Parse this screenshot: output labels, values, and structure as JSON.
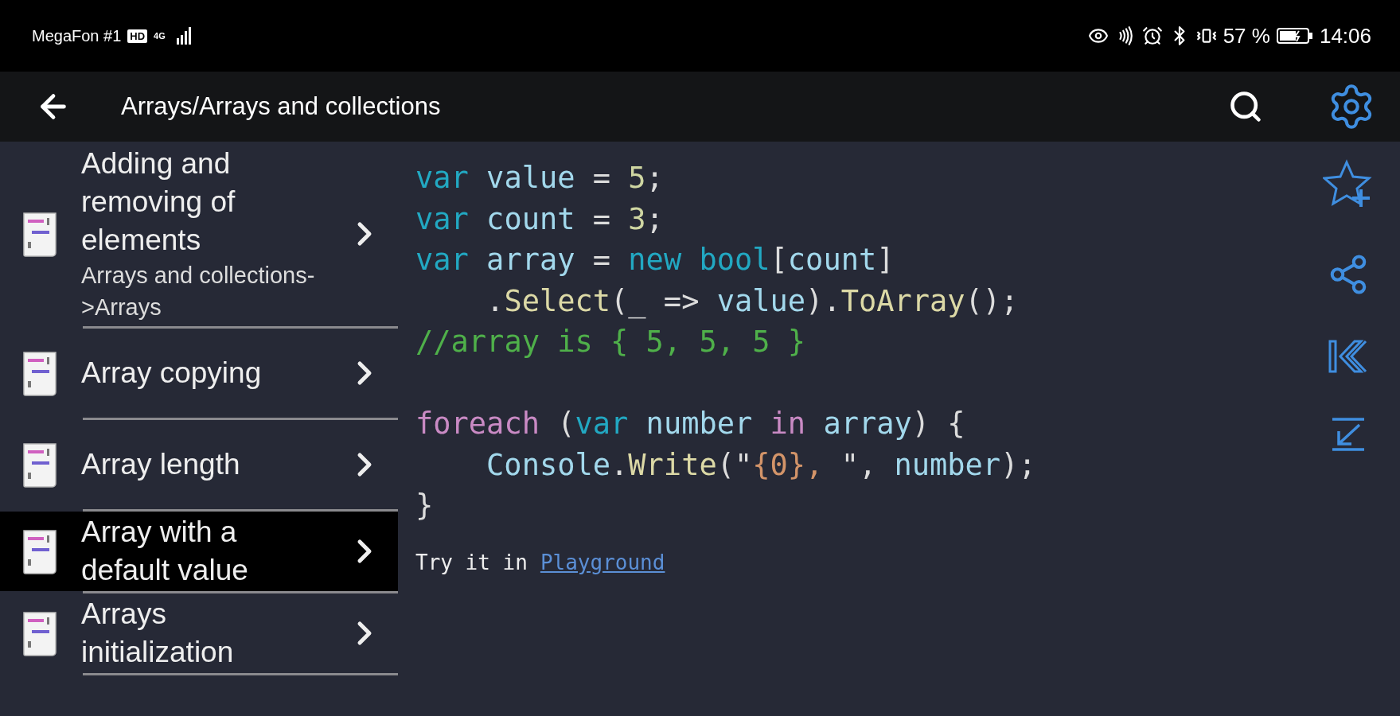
{
  "status_bar": {
    "carrier": "MegaFon #1",
    "hd_badge": "HD",
    "network": "4G",
    "battery_percent": "57 %",
    "time": "14:06"
  },
  "toolbar": {
    "title": "Arrays/Arrays and collections"
  },
  "sidebar": {
    "items": [
      {
        "title": "Adding and removing of elements",
        "subtitle": "Arrays and collections->Arrays",
        "selected": false
      },
      {
        "title": "Array copying",
        "selected": false
      },
      {
        "title": "Array length",
        "selected": false
      },
      {
        "title": "Array with a default value",
        "selected": true
      },
      {
        "title": "Arrays initialization",
        "selected": false
      }
    ]
  },
  "code": {
    "lines": [
      {
        "indent": false,
        "gap_before": false,
        "tokens": [
          {
            "kind": "keyword",
            "text": "var "
          },
          {
            "kind": "ident",
            "text": "value"
          },
          {
            "kind": "plain",
            "text": " = "
          },
          {
            "kind": "number",
            "text": "5"
          },
          {
            "kind": "plain",
            "text": ";"
          }
        ]
      },
      {
        "indent": false,
        "gap_before": false,
        "tokens": [
          {
            "kind": "keyword",
            "text": "var "
          },
          {
            "kind": "ident",
            "text": "count"
          },
          {
            "kind": "plain",
            "text": " = "
          },
          {
            "kind": "number",
            "text": "3"
          },
          {
            "kind": "plain",
            "text": ";"
          }
        ]
      },
      {
        "indent": false,
        "gap_before": false,
        "tokens": [
          {
            "kind": "keyword",
            "text": "var "
          },
          {
            "kind": "ident",
            "text": "array"
          },
          {
            "kind": "plain",
            "text": " = "
          },
          {
            "kind": "keyword",
            "text": "new "
          },
          {
            "kind": "keyword",
            "text": "bool"
          },
          {
            "kind": "plain",
            "text": "["
          },
          {
            "kind": "ident",
            "text": "count"
          },
          {
            "kind": "plain",
            "text": "]"
          }
        ]
      },
      {
        "indent": true,
        "gap_before": false,
        "tokens": [
          {
            "kind": "plain",
            "text": "."
          },
          {
            "kind": "method",
            "text": "Select"
          },
          {
            "kind": "plain",
            "text": "(_ => "
          },
          {
            "kind": "ident",
            "text": "value"
          },
          {
            "kind": "plain",
            "text": ")."
          },
          {
            "kind": "method",
            "text": "ToArray"
          },
          {
            "kind": "plain",
            "text": "();"
          }
        ]
      },
      {
        "indent": false,
        "gap_before": false,
        "tokens": [
          {
            "kind": "comment",
            "text": "//array is { 5, 5, 5 }"
          }
        ]
      },
      {
        "indent": false,
        "gap_before": true,
        "tokens": [
          {
            "kind": "control",
            "text": "foreach"
          },
          {
            "kind": "plain",
            "text": " ("
          },
          {
            "kind": "keyword",
            "text": "var "
          },
          {
            "kind": "ident",
            "text": "number "
          },
          {
            "kind": "control",
            "text": "in "
          },
          {
            "kind": "ident",
            "text": "array"
          },
          {
            "kind": "plain",
            "text": ") {"
          }
        ]
      },
      {
        "indent": true,
        "gap_before": false,
        "tokens": [
          {
            "kind": "ident",
            "text": "Console"
          },
          {
            "kind": "plain",
            "text": "."
          },
          {
            "kind": "method",
            "text": "Write"
          },
          {
            "kind": "plain",
            "text": "(\""
          },
          {
            "kind": "string",
            "text": "{0}, "
          },
          {
            "kind": "plain",
            "text": "\", "
          },
          {
            "kind": "ident",
            "text": "number"
          },
          {
            "kind": "plain",
            "text": ");"
          }
        ]
      },
      {
        "indent": false,
        "gap_before": false,
        "tokens": [
          {
            "kind": "plain",
            "text": "}"
          }
        ]
      }
    ],
    "try_text": "Try it in",
    "link": "Playground"
  }
}
